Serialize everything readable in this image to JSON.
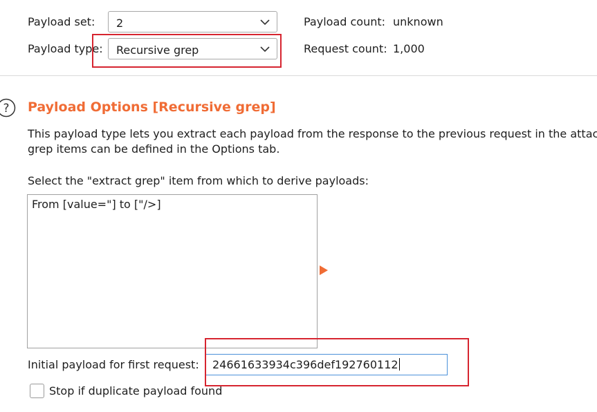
{
  "payload_set": {
    "label": "Payload set:",
    "value": "2"
  },
  "payload_type": {
    "label": "Payload type:",
    "value": "Recursive grep"
  },
  "payload_count": {
    "label": "Payload count:",
    "value": "unknown"
  },
  "request_count": {
    "label": "Request count:",
    "value": "1,000"
  },
  "section": {
    "title": "Payload Options [Recursive grep]",
    "description_line1": "This payload type lets you extract each payload from the response to the previous request in the attac",
    "description_line2": "grep items can be defined in the Options tab."
  },
  "extract": {
    "label": "Select the \"extract grep\" item from which to derive payloads:",
    "items": [
      "From [value=\"] to [\"/>]"
    ]
  },
  "initial_payload": {
    "label": "Initial payload for first request:",
    "value": "24661633934c396def192760112"
  },
  "stop_duplicate": {
    "label": "Stop if duplicate payload found",
    "checked": false
  },
  "colors": {
    "accent": "#f06c35",
    "highlight": "#d6242f",
    "focus": "#4a90d9"
  },
  "icons": {
    "help": "help-icon",
    "dropdown": "chevron-down-icon",
    "expand": "play-arrow-icon"
  }
}
